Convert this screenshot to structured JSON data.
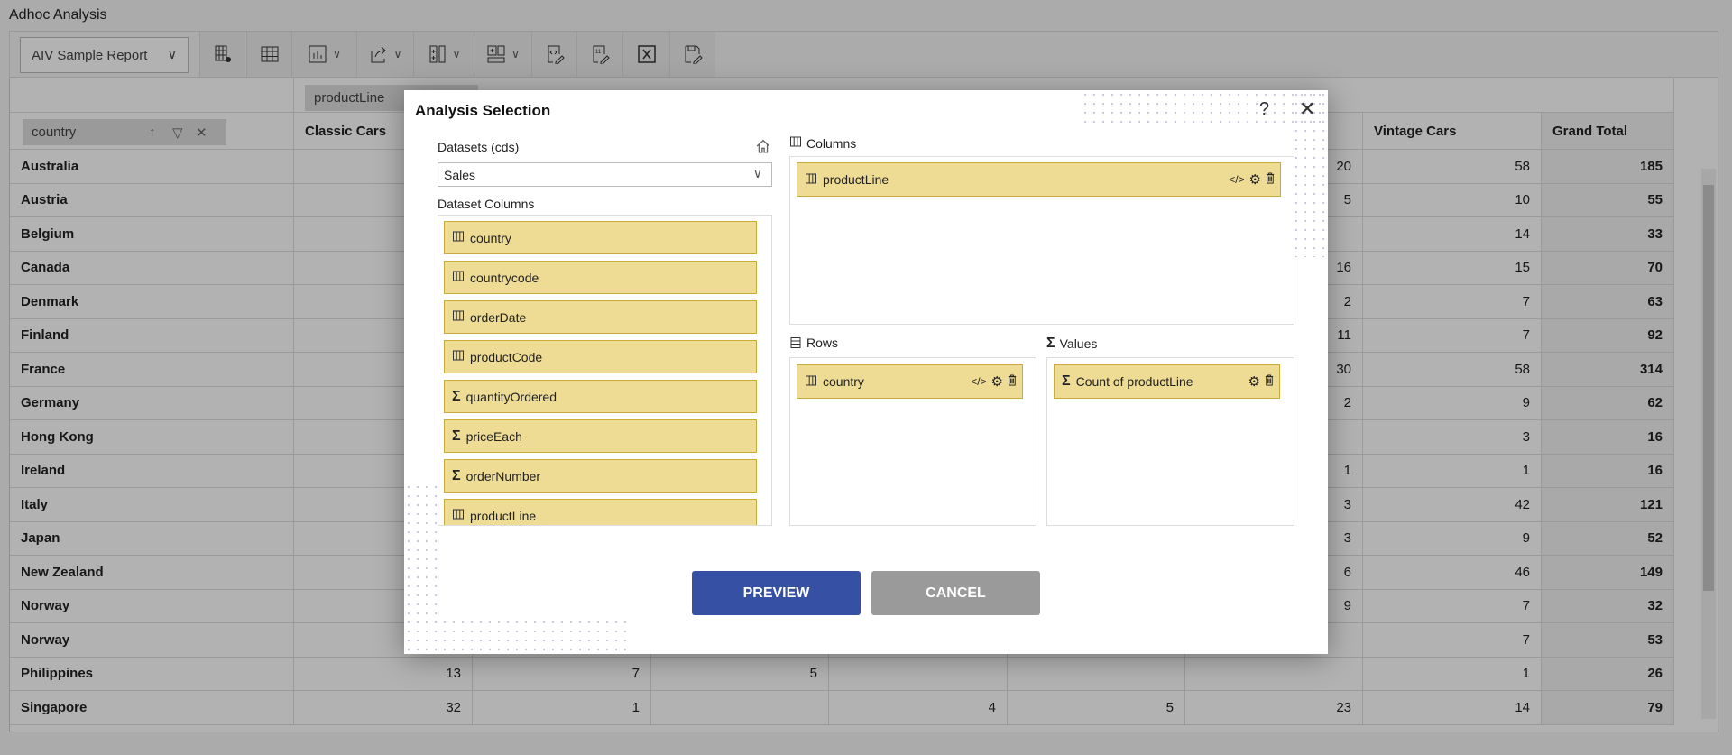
{
  "app": {
    "title": "Adhoc Analysis"
  },
  "toolbar": {
    "report_select": "AIV Sample Report",
    "icons": [
      "table-settings-icon",
      "table-icon",
      "chart-icon",
      "export-icon",
      "column-add-icon",
      "row-add-icon",
      "edit-code-icon",
      "edit-text-icon",
      "excel-icon",
      "save-edit-icon"
    ]
  },
  "pivot": {
    "column_chip": "productLine",
    "row_chip": "country",
    "headers": [
      "Classic Cars",
      "",
      "",
      "",
      "",
      "",
      "Vintage Cars",
      "Grand Total"
    ],
    "rows": [
      {
        "label": "Australia",
        "values": [
          "",
          "",
          "",
          "",
          "",
          "20",
          "58",
          "185"
        ]
      },
      {
        "label": "Austria",
        "values": [
          "",
          "",
          "",
          "",
          "",
          "5",
          "10",
          "55"
        ]
      },
      {
        "label": "Belgium",
        "values": [
          "",
          "",
          "",
          "",
          "",
          "",
          "14",
          "33"
        ]
      },
      {
        "label": "Canada",
        "values": [
          "",
          "",
          "",
          "",
          "",
          "16",
          "15",
          "70"
        ]
      },
      {
        "label": "Denmark",
        "values": [
          "",
          "",
          "",
          "",
          "",
          "2",
          "7",
          "63"
        ]
      },
      {
        "label": "Finland",
        "values": [
          "",
          "",
          "",
          "",
          "",
          "11",
          "7",
          "92"
        ]
      },
      {
        "label": "France",
        "values": [
          "",
          "",
          "",
          "",
          "",
          "30",
          "58",
          "314"
        ]
      },
      {
        "label": "Germany",
        "values": [
          "",
          "",
          "",
          "",
          "",
          "2",
          "9",
          "62"
        ]
      },
      {
        "label": "Hong Kong",
        "values": [
          "",
          "",
          "",
          "",
          "",
          "",
          "3",
          "16"
        ]
      },
      {
        "label": "Ireland",
        "values": [
          "",
          "",
          "",
          "",
          "",
          "1",
          "1",
          "16"
        ]
      },
      {
        "label": "Italy",
        "values": [
          "",
          "",
          "",
          "",
          "",
          "3",
          "42",
          "121"
        ]
      },
      {
        "label": "Japan",
        "values": [
          "",
          "",
          "",
          "",
          "",
          "3",
          "9",
          "52"
        ]
      },
      {
        "label": "New Zealand",
        "values": [
          "",
          "",
          "",
          "",
          "",
          "6",
          "46",
          "149"
        ]
      },
      {
        "label": "Norway",
        "values": [
          "",
          "",
          "",
          "",
          "",
          "9",
          "7",
          "32"
        ]
      },
      {
        "label": "Norway",
        "values": [
          "",
          "",
          "",
          "",
          "",
          "",
          "7",
          "53"
        ]
      },
      {
        "label": "Philippines",
        "values": [
          "13",
          "7",
          "5",
          "",
          "",
          "",
          "1",
          "26"
        ]
      },
      {
        "label": "Singapore",
        "values": [
          "32",
          "1",
          "",
          "4",
          "5",
          "23",
          "14",
          "79"
        ]
      }
    ]
  },
  "modal": {
    "title": "Analysis Selection",
    "help": "?",
    "datasets_label": "Datasets (cds)",
    "dataset_value": "Sales",
    "dataset_columns_label": "Dataset Columns",
    "dataset_columns": [
      {
        "name": "country",
        "type": "dimension"
      },
      {
        "name": "countrycode",
        "type": "dimension"
      },
      {
        "name": "orderDate",
        "type": "dimension"
      },
      {
        "name": "productCode",
        "type": "dimension"
      },
      {
        "name": "quantityOrdered",
        "type": "measure"
      },
      {
        "name": "priceEach",
        "type": "measure"
      },
      {
        "name": "orderNumber",
        "type": "measure"
      },
      {
        "name": "productLine",
        "type": "dimension"
      }
    ],
    "columns_label": "Columns",
    "columns_items": [
      "productLine"
    ],
    "rows_label": "Rows",
    "rows_items": [
      "country"
    ],
    "values_label": "Values",
    "values_items": [
      "Count of productLine"
    ],
    "preview": "PREVIEW",
    "cancel": "CANCEL",
    "colors": {
      "preview": "#3650a3",
      "cancel": "#9a9a9a",
      "item_bg": "#eedc95",
      "item_border": "#c9ab3a"
    }
  }
}
